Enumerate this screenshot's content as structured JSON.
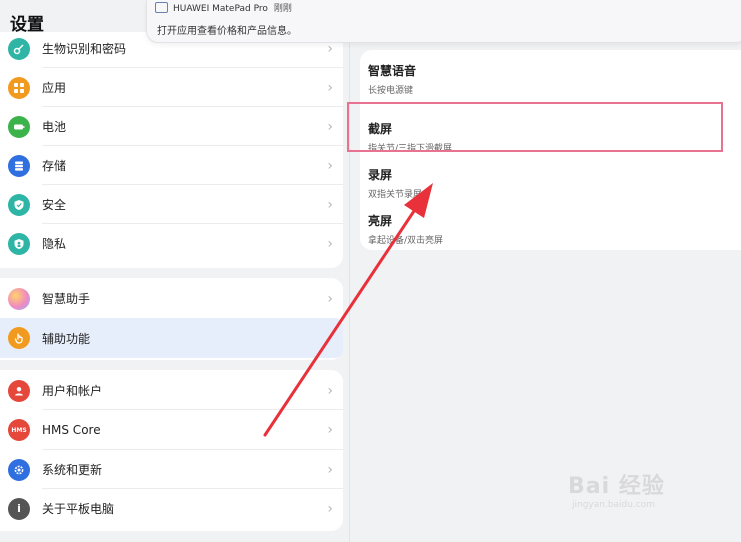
{
  "page_title": "设置",
  "notification": {
    "source": "HUAWEI MatePad Pro",
    "time": "刚刚",
    "body": "打开应用查看价格和产品信息。"
  },
  "sidebar": {
    "group1": [
      {
        "label": "生物识别和密码",
        "icon": "key-icon",
        "color": "#2fb5a6"
      },
      {
        "label": "应用",
        "icon": "apps-grid-icon",
        "color": "#f29a1f"
      },
      {
        "label": "电池",
        "icon": "battery-icon",
        "color": "#3bb34a"
      },
      {
        "label": "存储",
        "icon": "storage-icon",
        "color": "#2f6fe0"
      },
      {
        "label": "安全",
        "icon": "shield-icon",
        "color": "#2fb5a6"
      },
      {
        "label": "隐私",
        "icon": "privacy-icon",
        "color": "#2fb5a6"
      }
    ],
    "group2": [
      {
        "label": "智慧助手",
        "icon": "assistant-orb-icon",
        "color": "#c98ef0"
      },
      {
        "label": "辅助功能",
        "icon": "hand-icon",
        "color": "#f29a1f"
      }
    ],
    "group3": [
      {
        "label": "用户和帐户",
        "icon": "user-icon",
        "color": "#e5473b"
      },
      {
        "label": "HMS Core",
        "icon": "hms-icon",
        "color": "#e5473b",
        "icon_text": "HMS"
      },
      {
        "label": "系统和更新",
        "icon": "gear-icon",
        "color": "#2f6fe0"
      },
      {
        "label": "关于平板电脑",
        "icon": "info-icon",
        "color": "#555555"
      }
    ]
  },
  "detail": {
    "items": [
      {
        "title": "智慧语音",
        "subtitle": "长按电源键"
      },
      {
        "title": "截屏",
        "subtitle": "指关节/三指下滑截屏"
      },
      {
        "title": "录屏",
        "subtitle": "双指关节录屏"
      },
      {
        "title": "亮屏",
        "subtitle": "拿起设备/双击亮屏"
      }
    ]
  },
  "watermark": {
    "main": "Bai 经验",
    "sub": "jingyan.baidu.com"
  },
  "colors": {
    "highlight_border": "#e8728f",
    "arrow": "#e8313a",
    "active_row": "#e6eefb"
  }
}
